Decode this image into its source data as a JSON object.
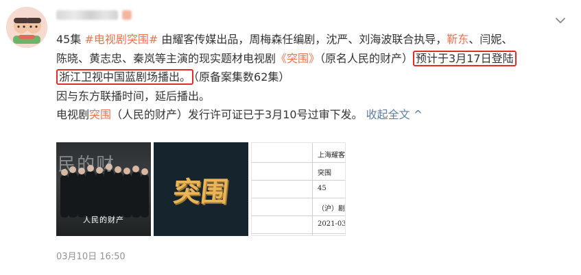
{
  "user": {
    "name_obscured": true
  },
  "post": {
    "lines": [
      [
        {
          "t": "45集 ",
          "c": ""
        },
        {
          "t": "#电视剧突围#",
          "c": "link"
        },
        {
          "t": " 由耀客传媒出品，周梅森任编剧，沈严、刘海波联合执导，",
          "c": ""
        },
        {
          "t": "靳东",
          "c": "hl"
        },
        {
          "t": "、闫妮、",
          "c": ""
        }
      ],
      [
        {
          "t": "陈晓、黄志忠、秦岚等主演的现实题材电视剧",
          "c": ""
        },
        {
          "t": "《突围》",
          "c": "link"
        },
        {
          "t": "（原名人民的财产）",
          "c": ""
        },
        {
          "t": "预计于3月17日登陆",
          "c": "box"
        }
      ],
      [
        {
          "t": "浙江卫视中国蓝剧场播出。",
          "c": "box"
        },
        {
          "t": "（原备案集数62集）",
          "c": ""
        }
      ],
      [
        {
          "t": "因与东方联播时间，延后播出。",
          "c": ""
        }
      ],
      [
        {
          "t": "电视剧",
          "c": ""
        },
        {
          "t": "突围",
          "c": "hl"
        },
        {
          "t": "（人民的财产）发行许可证已于3月10号过审下发。",
          "c": ""
        },
        {
          "t": " 收起全文",
          "c": "collapse"
        }
      ]
    ],
    "collapse_arrow": "^",
    "images": {
      "poster_bg_text": "民的财",
      "poster_title": "人民的财产",
      "logo_text": "突围",
      "doc_rows": [
        "上海耀客",
        "突围",
        "45",
        "（沪）剧",
        "2021-03-"
      ]
    },
    "timestamp": "03月10日 16:50"
  },
  "colors": {
    "link": "#eb7350",
    "collapse": "#5d7ea1",
    "highlight_box": "#e52a2a",
    "text": "#333333",
    "meta": "#939393"
  },
  "icons": {
    "menu": "chevron-down-icon"
  }
}
